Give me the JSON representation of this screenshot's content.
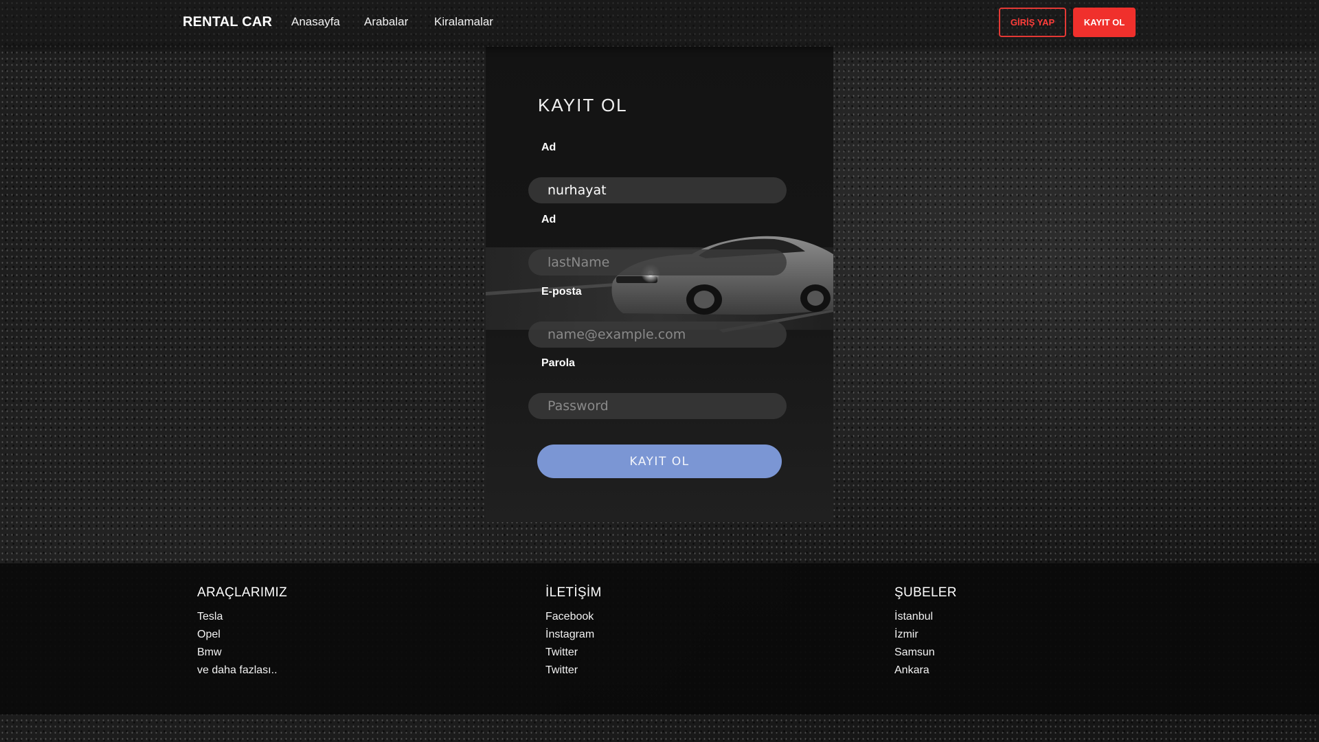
{
  "nav": {
    "brand": "RENTAL CAR",
    "links": [
      {
        "label": "Anasayfa"
      },
      {
        "label": "Arabalar"
      },
      {
        "label": "Kiralamalar"
      }
    ],
    "login_label": "GİRİŞ YAP",
    "register_label": "KAYIT OL"
  },
  "form": {
    "title": "KAYIT OL",
    "fields": [
      {
        "label": "Ad",
        "value": "nurhayat",
        "placeholder": "",
        "type": "text"
      },
      {
        "label": "Ad",
        "value": "",
        "placeholder": "lastName",
        "type": "text"
      },
      {
        "label": "E-posta",
        "value": "",
        "placeholder": "name@example.com",
        "type": "email"
      },
      {
        "label": "Parola",
        "value": "",
        "placeholder": "Password",
        "type": "password"
      }
    ],
    "submit_label": "KAYIT OL"
  },
  "footer": {
    "columns": [
      {
        "heading": "ARAÇLARIMIZ",
        "items": [
          "Tesla",
          "Opel",
          "Bmw",
          "ve daha fazlası.."
        ]
      },
      {
        "heading": "İLETİŞİM",
        "items": [
          "Facebook",
          "İnstagram",
          "Twitter",
          "Twitter"
        ]
      },
      {
        "heading": "ŞUBELER",
        "items": [
          "İstanbul",
          "İzmir",
          "Samsun",
          "Ankara"
        ]
      }
    ]
  },
  "colors": {
    "accent_red": "#f0302c",
    "submit_blue": "#7b96d4"
  }
}
